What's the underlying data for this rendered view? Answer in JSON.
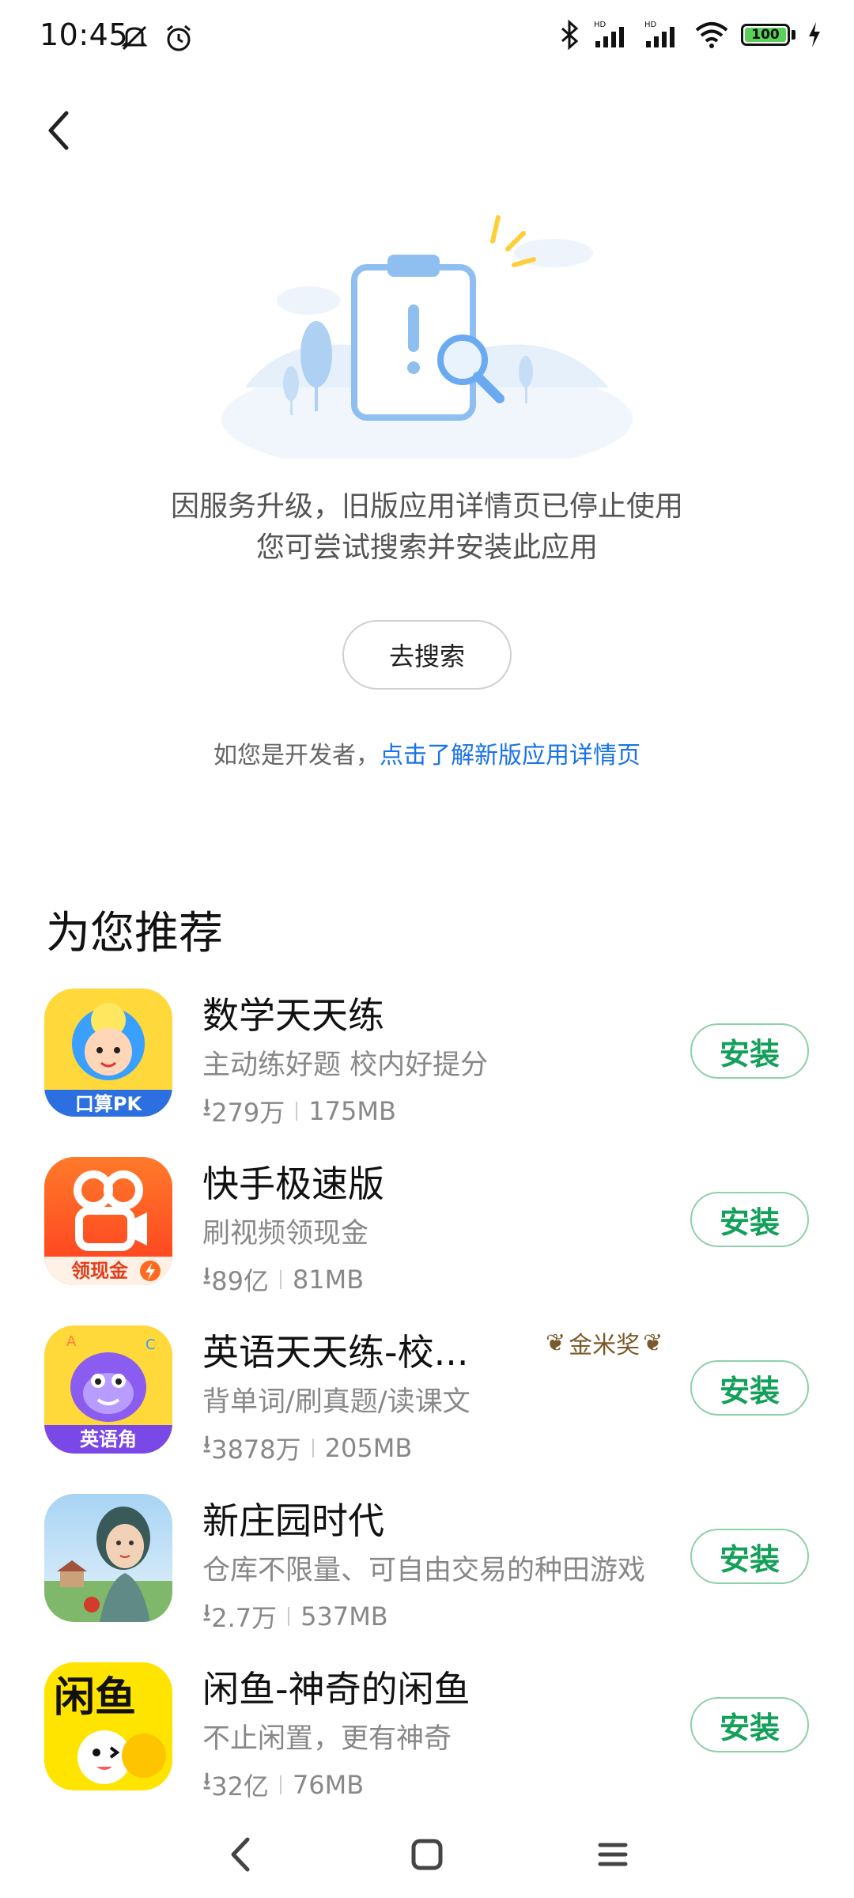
{
  "status_bar": {
    "time": "10:45",
    "battery": "100",
    "icons": [
      "mute-icon",
      "alarm-icon",
      "bluetooth-icon",
      "signal-hd-icon",
      "signal-hd-icon",
      "wifi-icon",
      "battery-icon",
      "charging-icon"
    ]
  },
  "notice": {
    "line1": "因服务升级，旧版应用详情页已停止使用",
    "line2": "您可尝试搜索并安装此应用",
    "search_label": "去搜索",
    "dev_prefix": "如您是开发者，",
    "dev_link": "点击了解新版应用详情页"
  },
  "recommend": {
    "title": "为您推荐",
    "apps": [
      {
        "name": "数学天天练",
        "desc": "主动练好题 校内好提分",
        "downloads": "279万",
        "size": "175MB",
        "install": "安装"
      },
      {
        "name": "快手极速版",
        "desc": "刷视频领现金",
        "downloads": "89亿",
        "size": "81MB",
        "install": "安装"
      },
      {
        "name": "英语天天练-校...",
        "badge": "金米奖",
        "desc": "背单词/刷真题/读课文",
        "downloads": "3878万",
        "size": "205MB",
        "install": "安装"
      },
      {
        "name": "新庄园时代",
        "desc": "仓库不限量、可自由交易的种田游戏",
        "downloads": "2.7万",
        "size": "537MB",
        "install": "安装"
      },
      {
        "name": "闲鱼-神奇的闲鱼",
        "desc": "不止闲置，更有神奇",
        "downloads": "32亿",
        "size": "76MB",
        "install": "安装"
      }
    ]
  },
  "icon_text": {
    "math": "口算PK",
    "kuaishou": "领现金",
    "english": "英语角",
    "xianyu": "闲鱼"
  },
  "colors": {
    "install_green": "#14a05a",
    "link_blue": "#1a73e8",
    "kuaishou_orange": "#ff5a1f",
    "xianyu_yellow": "#ffe400"
  }
}
